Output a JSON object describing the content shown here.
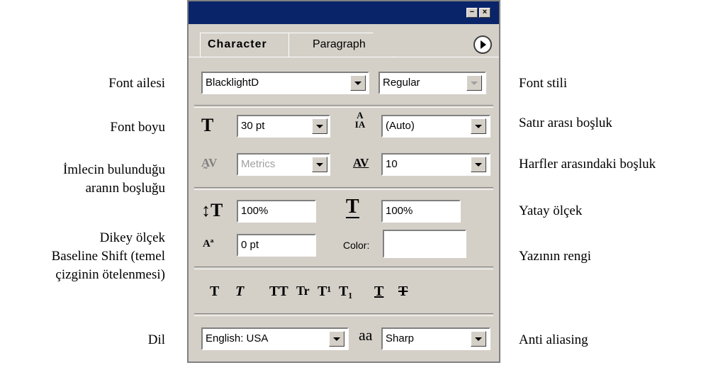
{
  "labels_left": {
    "font_family": "Font ailesi",
    "font_size": "Font boyu",
    "kerning_1": "İmlecin bulunduğu",
    "kerning_2": "aranın boşluğu",
    "vertical_scale": "Dikey ölçek",
    "baseline_1": "Baseline Shift (temel",
    "baseline_2": "çizginin ötelenmesi)",
    "language": "Dil"
  },
  "labels_right": {
    "font_style": "Font stili",
    "leading": "Satır arası boşluk",
    "tracking": "Harfler arasındaki boşluk",
    "horizontal_scale": "Yatay ölçek",
    "text_color": "Yazının rengi",
    "anti_aliasing": "Anti aliasing"
  },
  "panel": {
    "tabs": [
      "Character",
      "Paragraph"
    ],
    "minimize_glyph": "−",
    "close_glyph": "×",
    "font_family": "BlacklightD",
    "font_style": "Regular",
    "font_size": "30 pt",
    "leading": "(Auto)",
    "kerning": "Metrics",
    "tracking": "10",
    "vertical_scale": "100%",
    "horizontal_scale": "100%",
    "baseline_shift": "0 pt",
    "color_label": "Color:",
    "style_buttons": [
      "T",
      "T",
      "TT",
      "Tr",
      "T¹",
      "T₁",
      "T",
      "T"
    ],
    "language": "English: USA",
    "aa_glyph": "aa",
    "anti_aliasing": "Sharp",
    "colors": {
      "title_bar": "#0a246a",
      "panel_bg": "#d4d0c8"
    }
  }
}
